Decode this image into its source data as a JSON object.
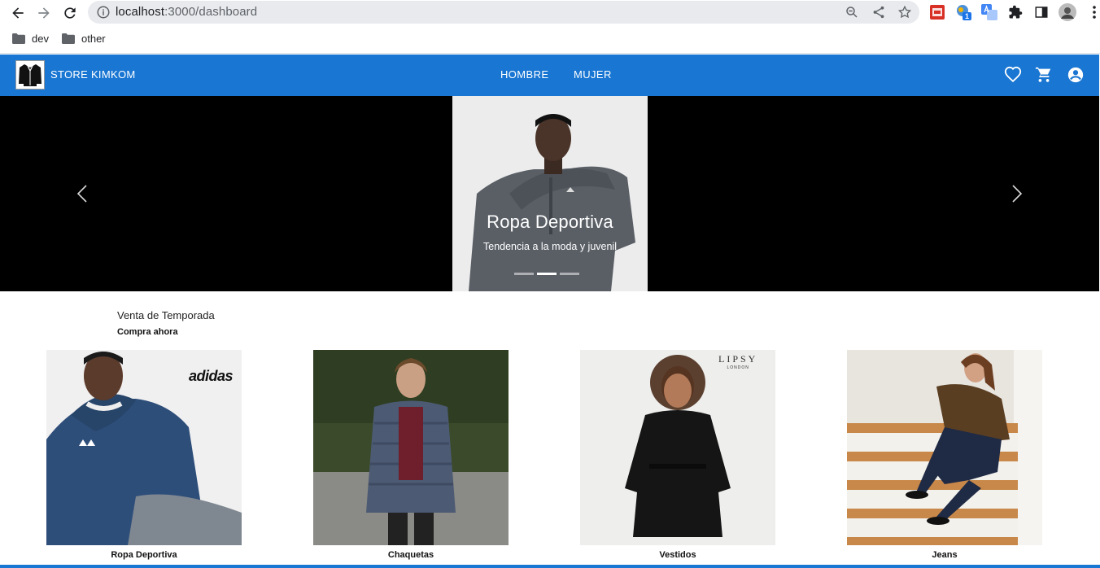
{
  "browser": {
    "url_host": "localhost",
    "url_path": ":3000/dashboard",
    "extension_badge": "1",
    "bookmarks": [
      {
        "label": "dev"
      },
      {
        "label": "other"
      }
    ]
  },
  "appbar": {
    "brand": "STORE KIMKOM",
    "menu": [
      "HOMBRE",
      "MUJER"
    ],
    "color": "#1976d2"
  },
  "carousel": {
    "title": "Ropa Deportiva",
    "subtitle": "Tendencia a la moda y juvenil",
    "slides": 3,
    "active_slide": 2
  },
  "section": {
    "title": "Venta de Temporada",
    "subtitle": "Compra ahora"
  },
  "products": [
    {
      "label": "Ropa Deportiva",
      "brand_mark": "adidas"
    },
    {
      "label": "Chaquetas"
    },
    {
      "label": "Vestidos",
      "brand_mark": "LIPSY",
      "brand_sub": "LONDON"
    },
    {
      "label": "Jeans"
    }
  ]
}
